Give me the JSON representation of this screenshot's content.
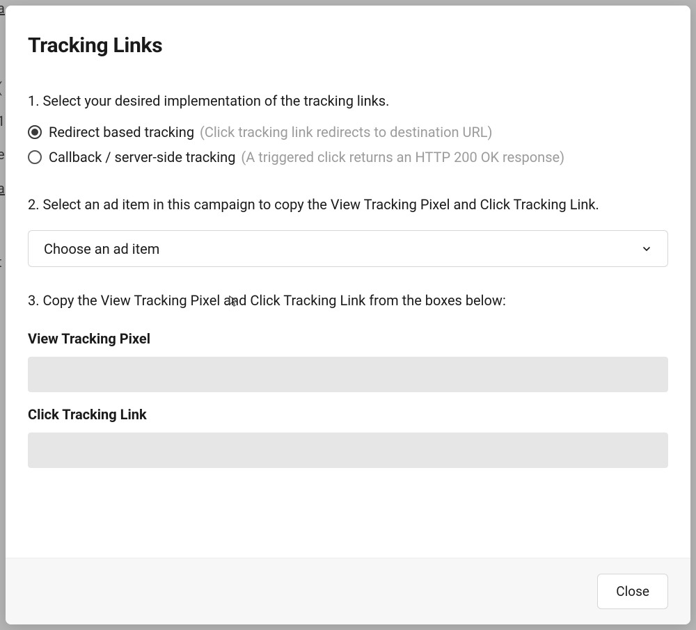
{
  "modal": {
    "title": "Tracking Links",
    "step1_text": "1. Select your desired implementation of the tracking links.",
    "radio_options": [
      {
        "label": "Redirect based tracking",
        "hint": "(Click tracking link redirects to destination URL)",
        "selected": true
      },
      {
        "label": "Callback / server-side tracking",
        "hint": "(A triggered click returns an HTTP 200 OK response)",
        "selected": false
      }
    ],
    "step2_text": "2. Select an ad item in this campaign to copy the View Tracking Pixel and Click Tracking Link.",
    "select_placeholder": "Choose an ad item",
    "step3_text": "3. Copy the View Tracking Pixel and Click Tracking Link from the boxes below:",
    "view_pixel_label": "View Tracking Pixel",
    "view_pixel_value": "",
    "click_link_label": "Click Tracking Link",
    "click_link_value": "",
    "close_button": "Close"
  }
}
